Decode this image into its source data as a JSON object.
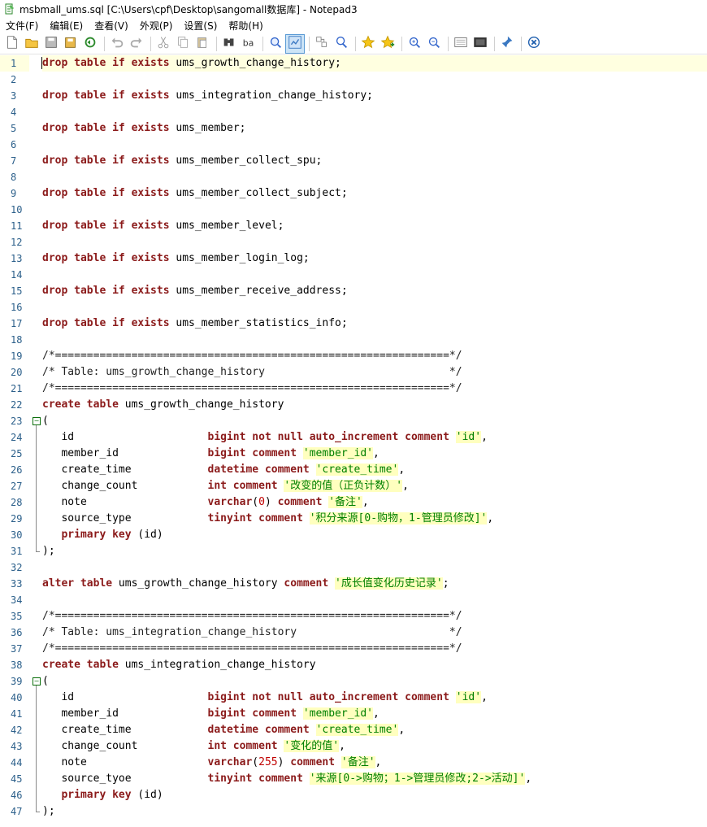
{
  "window": {
    "title": "msbmall_ums.sql [C:\\Users\\cpf\\Desktop\\sangomall数据库] - Notepad3"
  },
  "menu": [
    "文件(F)",
    "编辑(E)",
    "查看(V)",
    "外观(P)",
    "设置(S)",
    "帮助(H)"
  ],
  "toolbar": [
    "new-file-icon",
    "open-folder-icon",
    "save-icon",
    "save-as-icon",
    "revert-icon",
    "sep",
    "undo-icon",
    "redo-icon",
    "sep",
    "cut-icon",
    "copy-icon",
    "paste-icon",
    "sep",
    "find-icon",
    "replace-icon",
    "sep",
    "zoom-find-icon",
    "word-wrap-icon",
    "sep",
    "goto-icon",
    "find-next-icon",
    "sep",
    "favorite-icon",
    "add-favorite-icon",
    "sep",
    "zoom-in-icon",
    "zoom-out-icon",
    "sep",
    "scheme-icon",
    "customize-icon",
    "sep",
    "pin-icon",
    "sep",
    "close-icon"
  ],
  "colors": {
    "keyword": "#8b1a1a",
    "string": "#008000",
    "string_bg": "#ffffbf",
    "number": "#c00000",
    "line_number": "#2b5f8a",
    "current_line": "#ffffe0"
  },
  "lines": [
    [
      [
        "kw",
        "drop table if exists"
      ],
      [
        "t",
        " ums_growth_change_history;"
      ]
    ],
    [],
    [
      [
        "kw",
        "drop table if exists"
      ],
      [
        "t",
        " ums_integration_change_history;"
      ]
    ],
    [],
    [
      [
        "kw",
        "drop table if exists"
      ],
      [
        "t",
        " ums_member;"
      ]
    ],
    [],
    [
      [
        "kw",
        "drop table if exists"
      ],
      [
        "t",
        " ums_member_collect_spu;"
      ]
    ],
    [],
    [
      [
        "kw",
        "drop table if exists"
      ],
      [
        "t",
        " ums_member_collect_subject;"
      ]
    ],
    [],
    [
      [
        "kw",
        "drop table if exists"
      ],
      [
        "t",
        " ums_member_level;"
      ]
    ],
    [],
    [
      [
        "kw",
        "drop table if exists"
      ],
      [
        "t",
        " ums_member_login_log;"
      ]
    ],
    [],
    [
      [
        "kw",
        "drop table if exists"
      ],
      [
        "t",
        " ums_member_receive_address;"
      ]
    ],
    [],
    [
      [
        "kw",
        "drop table if exists"
      ],
      [
        "t",
        " ums_member_statistics_info;"
      ]
    ],
    [],
    [
      [
        "cmt",
        "/*==============================================================*/"
      ]
    ],
    [
      [
        "cmt",
        "/* Table: ums_growth_change_history                             */"
      ]
    ],
    [
      [
        "cmt",
        "/*==============================================================*/"
      ]
    ],
    [
      [
        "kw",
        "create table"
      ],
      [
        "t",
        " ums_growth_change_history"
      ]
    ],
    [
      [
        "t",
        "("
      ]
    ],
    [
      [
        "t",
        "   id                     "
      ],
      [
        "kw2",
        "bigint not null auto_increment comment"
      ],
      [
        "t",
        " "
      ],
      [
        "str",
        "'id'"
      ],
      [
        "t",
        ","
      ]
    ],
    [
      [
        "t",
        "   member_id              "
      ],
      [
        "kw2",
        "bigint comment"
      ],
      [
        "t",
        " "
      ],
      [
        "str",
        "'member_id'"
      ],
      [
        "t",
        ","
      ]
    ],
    [
      [
        "t",
        "   create_time            "
      ],
      [
        "kw2",
        "datetime comment"
      ],
      [
        "t",
        " "
      ],
      [
        "str",
        "'create_time'"
      ],
      [
        "t",
        ","
      ]
    ],
    [
      [
        "t",
        "   change_count           "
      ],
      [
        "kw2",
        "int comment"
      ],
      [
        "t",
        " "
      ],
      [
        "str",
        "'改变的值（正负计数）'"
      ],
      [
        "t",
        ","
      ]
    ],
    [
      [
        "t",
        "   note                   "
      ],
      [
        "kw2",
        "varchar"
      ],
      [
        "t",
        "("
      ],
      [
        "num",
        "0"
      ],
      [
        "t",
        ") "
      ],
      [
        "kw2",
        "comment"
      ],
      [
        "t",
        " "
      ],
      [
        "str",
        "'备注'"
      ],
      [
        "t",
        ","
      ]
    ],
    [
      [
        "t",
        "   source_type            "
      ],
      [
        "kw2",
        "tinyint comment"
      ],
      [
        "t",
        " "
      ],
      [
        "str",
        "'积分来源[0-购物，1-管理员修改]'"
      ],
      [
        "t",
        ","
      ]
    ],
    [
      [
        "t",
        "   "
      ],
      [
        "kw2",
        "primary key"
      ],
      [
        "t",
        " (id)"
      ]
    ],
    [
      [
        "t",
        ");"
      ]
    ],
    [],
    [
      [
        "kw",
        "alter table"
      ],
      [
        "t",
        " ums_growth_change_history "
      ],
      [
        "kw",
        "comment"
      ],
      [
        "t",
        " "
      ],
      [
        "str",
        "'成长值变化历史记录'"
      ],
      [
        "t",
        ";"
      ]
    ],
    [],
    [
      [
        "cmt",
        "/*==============================================================*/"
      ]
    ],
    [
      [
        "cmt",
        "/* Table: ums_integration_change_history                        */"
      ]
    ],
    [
      [
        "cmt",
        "/*==============================================================*/"
      ]
    ],
    [
      [
        "kw",
        "create table"
      ],
      [
        "t",
        " ums_integration_change_history"
      ]
    ],
    [
      [
        "t",
        "("
      ]
    ],
    [
      [
        "t",
        "   id                     "
      ],
      [
        "kw2",
        "bigint not null auto_increment comment"
      ],
      [
        "t",
        " "
      ],
      [
        "str",
        "'id'"
      ],
      [
        "t",
        ","
      ]
    ],
    [
      [
        "t",
        "   member_id              "
      ],
      [
        "kw2",
        "bigint comment"
      ],
      [
        "t",
        " "
      ],
      [
        "str",
        "'member_id'"
      ],
      [
        "t",
        ","
      ]
    ],
    [
      [
        "t",
        "   create_time            "
      ],
      [
        "kw2",
        "datetime comment"
      ],
      [
        "t",
        " "
      ],
      [
        "str",
        "'create_time'"
      ],
      [
        "t",
        ","
      ]
    ],
    [
      [
        "t",
        "   change_count           "
      ],
      [
        "kw2",
        "int comment"
      ],
      [
        "t",
        " "
      ],
      [
        "str",
        "'变化的值'"
      ],
      [
        "t",
        ","
      ]
    ],
    [
      [
        "t",
        "   note                   "
      ],
      [
        "kw2",
        "varchar"
      ],
      [
        "t",
        "("
      ],
      [
        "num",
        "255"
      ],
      [
        "t",
        ") "
      ],
      [
        "kw2",
        "comment"
      ],
      [
        "t",
        " "
      ],
      [
        "str",
        "'备注'"
      ],
      [
        "t",
        ","
      ]
    ],
    [
      [
        "t",
        "   source_tyoe            "
      ],
      [
        "kw2",
        "tinyint comment"
      ],
      [
        "t",
        " "
      ],
      [
        "str",
        "'来源[0->购物；1->管理员修改;2->活动]'"
      ],
      [
        "t",
        ","
      ]
    ],
    [
      [
        "t",
        "   "
      ],
      [
        "kw2",
        "primary key"
      ],
      [
        "t",
        " (id)"
      ]
    ],
    [
      [
        "t",
        ");"
      ]
    ]
  ],
  "line_numbers": [
    "1",
    "2",
    "3",
    "4",
    "5",
    "6",
    "7",
    "8",
    "9",
    "10",
    "11",
    "12",
    "13",
    "14",
    "15",
    "16",
    "17",
    "18",
    "19",
    "20",
    "21",
    "22",
    "23",
    "24",
    "25",
    "26",
    "27",
    "28",
    "29",
    "30",
    "31",
    "32",
    "33",
    "34",
    "35",
    "36",
    "37",
    "38",
    "39",
    "40",
    "41",
    "42",
    "43",
    "44",
    "45",
    "46",
    "47"
  ],
  "current_line": 1,
  "fold_markers": [
    23,
    39
  ]
}
